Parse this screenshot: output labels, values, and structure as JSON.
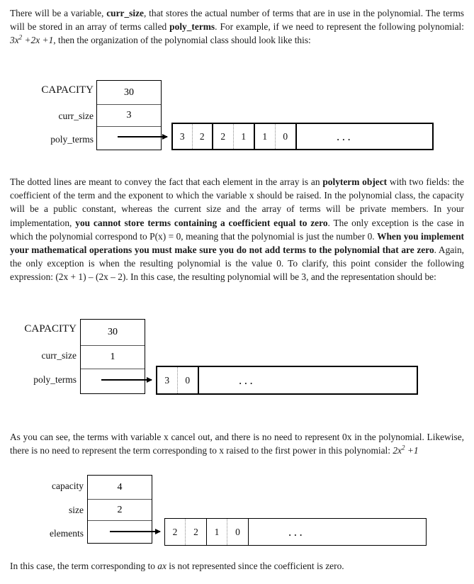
{
  "paragraphs": {
    "intro_1": "There will be a variable, ",
    "intro_b1": "curr_size",
    "intro_2": ", that stores the actual number of terms that are in use in the polynomial. The terms will be stored in an array of terms called ",
    "intro_b2": "poly_terms",
    "intro_3": ". For example, if we need to represent the following polynomial: ",
    "intro_math": "3x2 + 2x + 1",
    "intro_4": ", then the organization of the polynomial class should look like this:",
    "dotted_1": "The dotted lines are meant to convey the fact that each element in the array is an ",
    "dotted_b1": "polyterm object",
    "dotted_2": " with two fields: the coefficient of the term and the exponent to which the variable x should be raised. In the polynomial class, the capacity will be a public constant, whereas the current size and the array of terms will be private members. In your implementation, ",
    "dotted_b2": "you cannot store terms containing a coefficient equal to zero",
    "dotted_3": ". The only exception is the case in which the polynomial correspond to P(x) = 0, meaning that the polynomial is just the number 0. ",
    "dotted_b3": "When you implement your mathematical operations you must make sure you do not add terms to the polynomial that are zero",
    "dotted_4": ". Again, the only exception is when the resulting polynomial is the value 0. To clarify, this point consider the following expression: (2x + 1) – (2x – 2). In this case, the resulting polynomial will be 3, and the representation should be:",
    "cancel_1": "As you can see, the terms with variable x cancel out, and there is no need to represent 0x in the polynomial. Likewise, there is no need to represent the term corresponding to x raised to the first power in this polynomial: ",
    "cancel_math": "2x2 + 1",
    "final_1": "In this case, the term corresponding to ",
    "final_math": "ax",
    "final_2": " is not represented since the coefficient is zero."
  },
  "diagram1": {
    "labels": {
      "capacity": "CAPACITY",
      "size": "curr_size",
      "terms": "poly_terms"
    },
    "values": {
      "capacity": "30",
      "size": "3"
    },
    "array": {
      "terms": [
        {
          "coefficient": "3",
          "exponent": "2"
        },
        {
          "coefficient": "2",
          "exponent": "1"
        },
        {
          "coefficient": "1",
          "exponent": "0"
        }
      ],
      "ellipsis": "..."
    }
  },
  "diagram2": {
    "labels": {
      "capacity": "CAPACITY",
      "size": "curr_size",
      "terms": "poly_terms"
    },
    "values": {
      "capacity": "30",
      "size": "1"
    },
    "array": {
      "terms": [
        {
          "coefficient": "3",
          "exponent": "0"
        }
      ],
      "ellipsis": "..."
    }
  },
  "diagram3": {
    "labels": {
      "capacity": "capacity",
      "size": "size",
      "terms": "elements"
    },
    "values": {
      "capacity": "4",
      "size": "2"
    },
    "array": {
      "terms": [
        {
          "coefficient": "2",
          "exponent": "2"
        },
        {
          "coefficient": "1",
          "exponent": "0"
        }
      ],
      "ellipsis": "..."
    }
  }
}
